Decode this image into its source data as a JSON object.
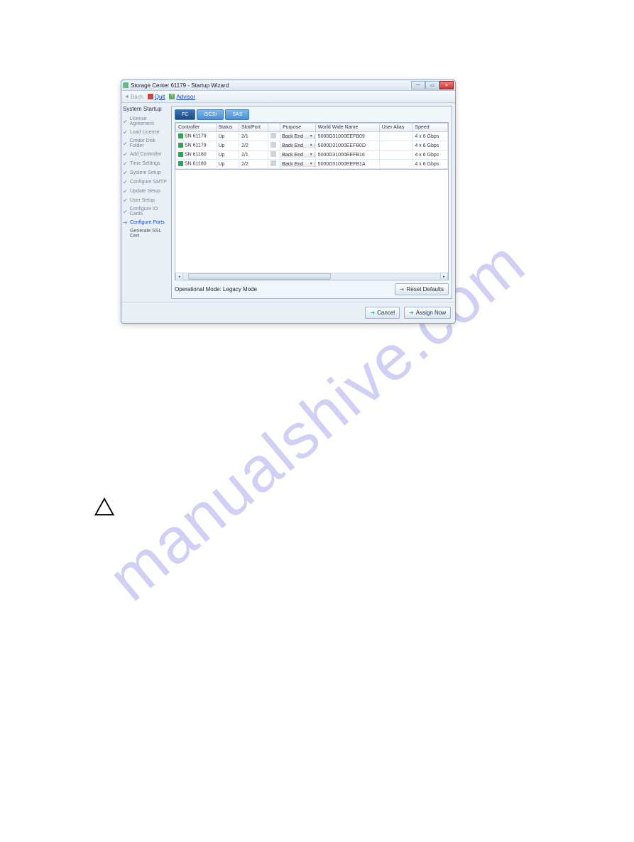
{
  "watermark": "manualshive.com",
  "window": {
    "title": "Storage Center 61179 - Startup Wizard",
    "controls": {
      "minimize": "—",
      "maximize": "▭",
      "close": "✕"
    }
  },
  "toolbar": {
    "back_label": "Back",
    "quit_label": "Quit",
    "advisor_label": "Advisor"
  },
  "sidebar": {
    "title": "System Startup",
    "items": [
      {
        "label": "License Agreement",
        "done": true
      },
      {
        "label": "Load License",
        "done": true
      },
      {
        "label": "Create Disk Folder",
        "done": true
      },
      {
        "label": "Add Controller",
        "done": true
      },
      {
        "label": "Time Settings",
        "done": true
      },
      {
        "label": "System Setup",
        "done": true
      },
      {
        "label": "Configure SMTP",
        "done": true
      },
      {
        "label": "Update Setup",
        "done": true
      },
      {
        "label": "User Setup",
        "done": true
      },
      {
        "label": "Configure IO Cards",
        "done": true
      },
      {
        "label": "Configure Ports",
        "active": true
      },
      {
        "label": "Generate SSL Cert",
        "plain": true
      }
    ]
  },
  "tabs": [
    {
      "label": "FC",
      "active": true
    },
    {
      "label": "iSCSI"
    },
    {
      "label": "SAS"
    }
  ],
  "table": {
    "headers": [
      "Controller",
      "Status",
      "Slot/Port",
      "",
      "Purpose",
      "World Wide Name",
      "User Alias",
      "Speed"
    ],
    "rows": [
      {
        "controller": "SN 61179",
        "status": "Up",
        "slotport": "2/1",
        "purpose": "Back End",
        "wwn": "5000D31000EEFB09",
        "alias": "",
        "speed": "4 x 6 Gbps"
      },
      {
        "controller": "SN 61179",
        "status": "Up",
        "slotport": "2/2",
        "purpose": "Back End",
        "wwn": "5000D31000EEFB0D",
        "alias": "",
        "speed": "4 x 6 Gbps"
      },
      {
        "controller": "SN 61180",
        "status": "Up",
        "slotport": "2/1",
        "purpose": "Back End",
        "wwn": "5000D31000EEFB16",
        "alias": "",
        "speed": "4 x 6 Gbps"
      },
      {
        "controller": "SN 61180",
        "status": "Up",
        "slotport": "2/2",
        "purpose": "Back End",
        "wwn": "5000D31000EEFB1A",
        "alias": "",
        "speed": "4 x 6 Gbps"
      }
    ]
  },
  "footer": {
    "op_mode": "Operational Mode: Legacy Mode",
    "reset_label": "Reset Defaults"
  },
  "dialog_buttons": {
    "cancel": "Cancel",
    "assign": "Assign Now"
  }
}
